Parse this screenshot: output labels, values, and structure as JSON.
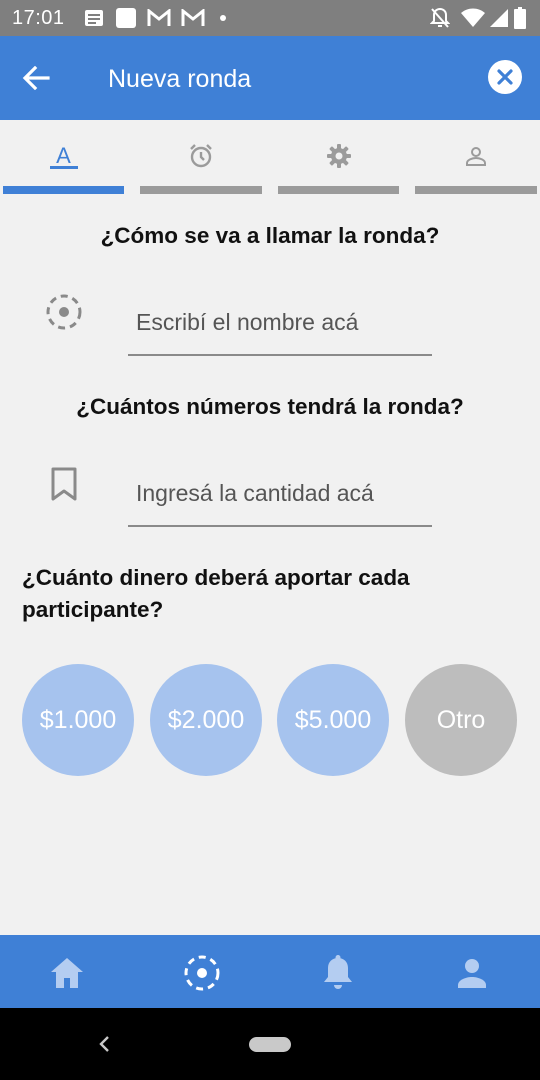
{
  "status_bar": {
    "time": "17:01",
    "left_icons": [
      "message-icon",
      "square-icon",
      "gmail-icon",
      "gmail-icon",
      "dot-icon"
    ],
    "right_icons": [
      "bell-off-icon",
      "wifi-icon",
      "signal-icon",
      "battery-icon"
    ]
  },
  "app_bar": {
    "title": "Nueva ronda",
    "back_icon": "arrow-left-icon",
    "close_icon": "close-circle-icon"
  },
  "tabs": [
    {
      "icon": "text-format-icon",
      "label": "A",
      "active": true
    },
    {
      "icon": "alarm-icon",
      "active": false
    },
    {
      "icon": "gear-icon",
      "active": false
    },
    {
      "icon": "person-icon",
      "active": false
    }
  ],
  "form": {
    "name_question": "¿Cómo se va a llamar la ronda?",
    "name_placeholder": "Escribí el nombre acá",
    "count_question": "¿Cuántos números tendrá la ronda?",
    "count_placeholder": "Ingresá la cantidad acá",
    "amount_question": "¿Cuánto dinero deberá aportar cada participante?",
    "amounts": [
      "$1.000",
      "$2.000",
      "$5.000",
      "Otro"
    ]
  },
  "bottom_nav": [
    "home-icon",
    "roulette-icon",
    "bell-icon",
    "person-icon"
  ],
  "colors": {
    "primary": "#3f80d6",
    "amount_blue": "#a6c3ee",
    "amount_grey": "#bdbdbd",
    "background": "#f1f1f1",
    "tab_inactive": "#9b9b9b"
  }
}
